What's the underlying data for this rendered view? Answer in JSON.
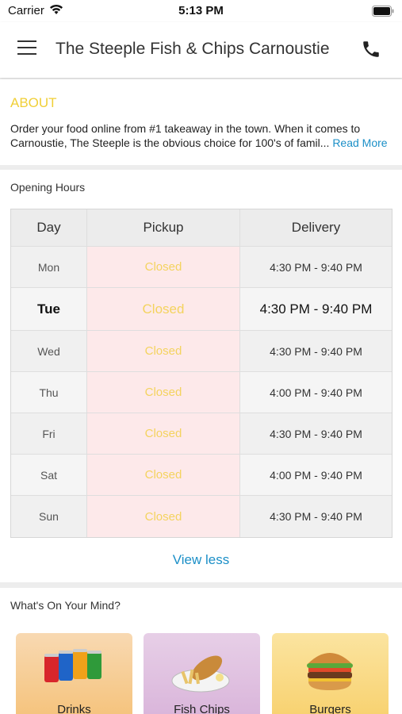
{
  "status_bar": {
    "carrier": "Carrier",
    "time": "5:13 PM"
  },
  "nav": {
    "title": "The Steeple Fish & Chips Carnoustie"
  },
  "about": {
    "title": "ABOUT",
    "text": "Order your food online from #1 takeaway in the town. When it comes to Carnoustie, The Steeple is the obvious choice for 100's of famil...",
    "read_more": "Read More"
  },
  "opening_hours": {
    "title": "Opening Hours",
    "headers": {
      "day": "Day",
      "pickup": "Pickup",
      "delivery": "Delivery"
    },
    "rows": [
      {
        "day": "Mon",
        "pickup": "Closed",
        "delivery": "4:30 PM - 9:40 PM"
      },
      {
        "day": "Tue",
        "pickup": "Closed",
        "delivery": "4:30 PM - 9:40 PM"
      },
      {
        "day": "Wed",
        "pickup": "Closed",
        "delivery": "4:30 PM - 9:40 PM"
      },
      {
        "day": "Thu",
        "pickup": "Closed",
        "delivery": "4:00 PM - 9:40 PM"
      },
      {
        "day": "Fri",
        "pickup": "Closed",
        "delivery": "4:30 PM - 9:40 PM"
      },
      {
        "day": "Sat",
        "pickup": "Closed",
        "delivery": "4:00 PM - 9:40 PM"
      },
      {
        "day": "Sun",
        "pickup": "Closed",
        "delivery": "4:30 PM - 9:40 PM"
      }
    ],
    "view_less": "View less"
  },
  "mind": {
    "title": "What's On Your Mind?",
    "categories": [
      {
        "label": "Drinks",
        "icon": "drinks-cans-image"
      },
      {
        "label": "Fish  Chips",
        "icon": "fish-chips-image"
      },
      {
        "label": "Burgers",
        "icon": "burger-image"
      }
    ]
  },
  "colors": {
    "accent_yellow": "#f0cf37",
    "link_blue": "#1b8fc7",
    "closed_bg": "#fde9ea"
  }
}
